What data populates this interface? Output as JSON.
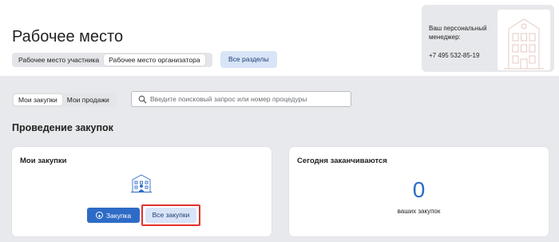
{
  "header": {
    "title": "Рабочее место",
    "mode_tabs": [
      {
        "label": "Рабочее место участника",
        "active": false
      },
      {
        "label": "Рабочее место организатора",
        "active": true
      }
    ],
    "all_sections_label": "Все разделы"
  },
  "manager": {
    "label": "Ваш персональный менеджер:",
    "phone": "+7 495 532-85-19"
  },
  "filter": {
    "tabs": [
      {
        "label": "Мои закупки",
        "active": true
      },
      {
        "label": "Мои продажи",
        "active": false
      }
    ],
    "search_placeholder": "Введите поисковый запрос или номер процедуры"
  },
  "section": {
    "title": "Проведение закупок"
  },
  "my_purchases_card": {
    "title": "Мои закупки",
    "add_button_label": "Закупка",
    "all_button_label": "Все закупки"
  },
  "ending_today_card": {
    "title": "Сегодня заканчиваются",
    "count": "0",
    "caption": "ваших закупок"
  },
  "colors": {
    "accent": "#2e6bc6",
    "secondary_button_bg": "#d8e4f7",
    "highlight_border": "#e2322c",
    "background": "#e8e9ec"
  }
}
